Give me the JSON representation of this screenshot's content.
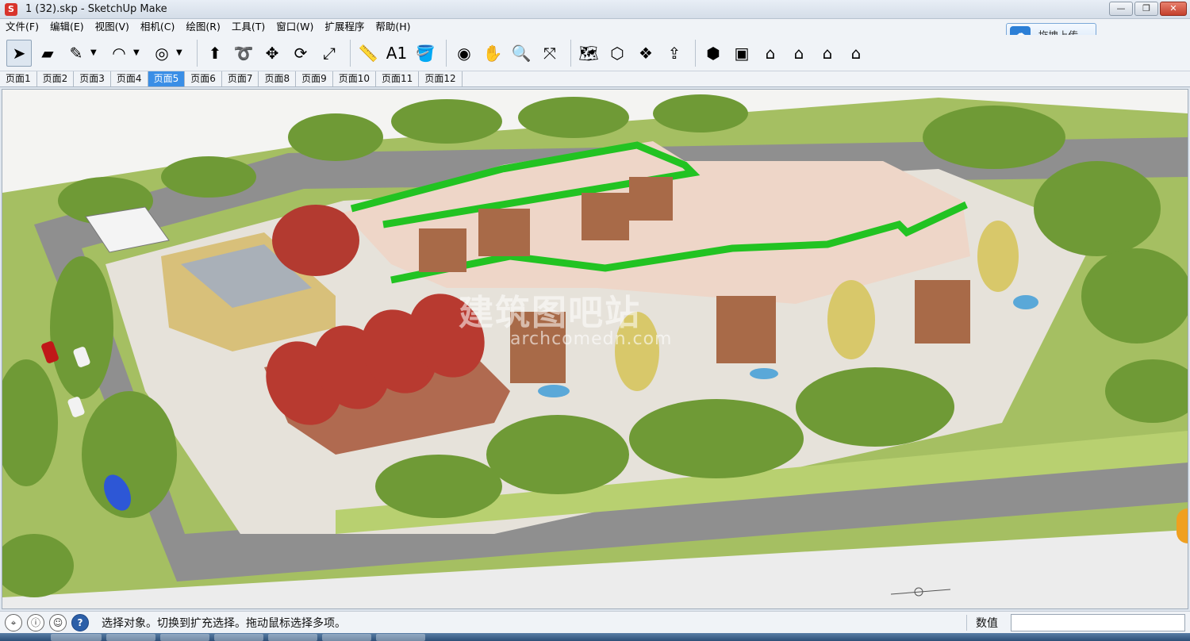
{
  "window": {
    "title": "1 (32).skp - SketchUp Make",
    "app_icon": "sketchup-icon",
    "minimize": "—",
    "restore": "❐",
    "close": "✕"
  },
  "menu": [
    "文件(F)",
    "编辑(E)",
    "视图(V)",
    "相机(C)",
    "绘图(R)",
    "工具(T)",
    "窗口(W)",
    "扩展程序",
    "帮助(H)"
  ],
  "upload": {
    "label": "拖拽上传",
    "icon": "cloud-upload-icon"
  },
  "toolbar": [
    {
      "icon": "select-arrow-icon",
      "glyph": "➤",
      "active": true
    },
    {
      "icon": "eraser-icon",
      "glyph": "▰"
    },
    {
      "icon": "pencil-line-icon",
      "glyph": "✎",
      "dropdown": true
    },
    {
      "icon": "arc-icon",
      "glyph": "◠",
      "dropdown": true
    },
    {
      "icon": "shape-circle-icon",
      "glyph": "◎",
      "dropdown": true
    },
    {
      "icon": "push-pull-icon",
      "glyph": "⬆"
    },
    {
      "icon": "follow-me-icon",
      "glyph": "➰"
    },
    {
      "icon": "move-icon",
      "glyph": "✥"
    },
    {
      "icon": "rotate-icon",
      "glyph": "⟳"
    },
    {
      "icon": "scale-icon",
      "glyph": "⤢"
    },
    {
      "icon": "tape-measure-icon",
      "glyph": "📏"
    },
    {
      "icon": "text-icon",
      "glyph": "A1"
    },
    {
      "icon": "paint-bucket-icon",
      "glyph": "🪣"
    },
    {
      "icon": "orbit-icon",
      "glyph": "◉"
    },
    {
      "icon": "pan-hand-icon",
      "glyph": "✋"
    },
    {
      "icon": "zoom-icon",
      "glyph": "🔍"
    },
    {
      "icon": "zoom-extents-icon",
      "glyph": "⤧"
    },
    {
      "icon": "map-icon",
      "glyph": "🗺"
    },
    {
      "icon": "warehouse-icon",
      "glyph": "⬡"
    },
    {
      "icon": "extension-icon",
      "glyph": "❖"
    },
    {
      "icon": "share-icon",
      "glyph": "⇪"
    },
    {
      "icon": "iso-view-icon",
      "glyph": "⬢"
    },
    {
      "icon": "top-view-icon",
      "glyph": "▣"
    },
    {
      "icon": "front-view-icon",
      "glyph": "⌂"
    },
    {
      "icon": "right-view-icon",
      "glyph": "⌂"
    },
    {
      "icon": "back-view-icon",
      "glyph": "⌂"
    },
    {
      "icon": "left-view-icon",
      "glyph": "⌂"
    }
  ],
  "tabs": [
    "页面1",
    "页面2",
    "页面3",
    "页面4",
    "页面5",
    "页面6",
    "页面7",
    "页面8",
    "页面9",
    "页面10",
    "页面11",
    "页面12"
  ],
  "active_tab": 4,
  "watermark": {
    "main": "建筑图吧站",
    "sub": "archcomedn.com"
  },
  "status": {
    "text": "选择对象。切换到扩充选择。拖动鼠标选择多项。",
    "measurements_label": "数值",
    "icons": [
      "geo-location-icon",
      "info-icon",
      "user-icon",
      "help-icon"
    ]
  },
  "colors": {
    "accent": "#3a8ee6",
    "roof_green": "#22c322",
    "roof_red": "#b83a30",
    "ground": "#9cb85a",
    "road": "#9a9a9a"
  }
}
